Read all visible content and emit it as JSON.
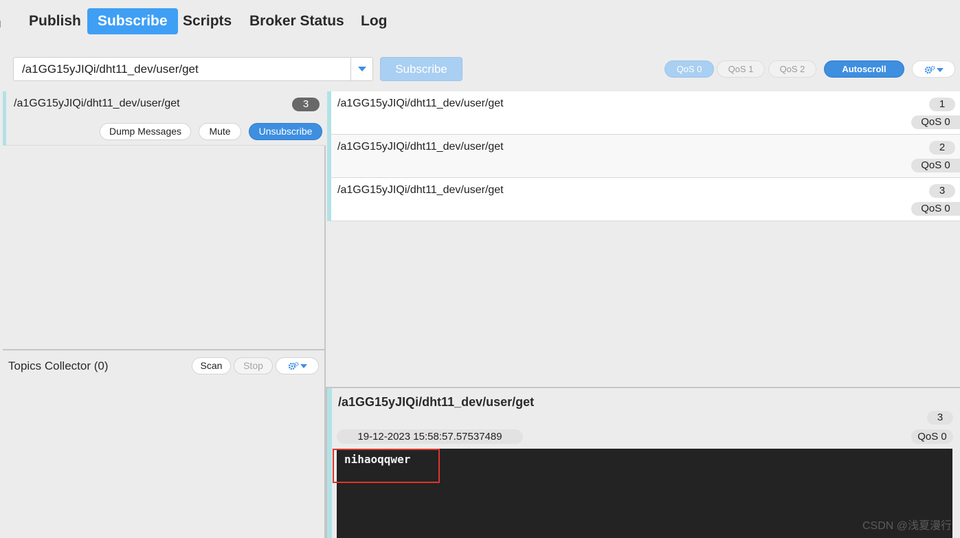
{
  "nav": {
    "tabs": [
      {
        "label": "Publish",
        "active": false
      },
      {
        "label": "Subscribe",
        "active": true
      },
      {
        "label": "Scripts",
        "active": false
      },
      {
        "label": "Broker Status",
        "active": false
      },
      {
        "label": "Log",
        "active": false
      }
    ]
  },
  "subscribe_bar": {
    "topic_value": "/a1GG15yJIQi/dht11_dev/user/get",
    "subscribe_label": "Subscribe",
    "qos_options": [
      "QoS 0",
      "QoS 1",
      "QoS 2"
    ],
    "selected_qos": "QoS 0",
    "autoscroll_label": "Autoscroll",
    "settings_icon": "gears-icon"
  },
  "subscriptions": [
    {
      "topic": "/a1GG15yJIQi/dht11_dev/user/get",
      "count": "3",
      "dump_label": "Dump Messages",
      "mute_label": "Mute",
      "unsubscribe_label": "Unsubscribe"
    }
  ],
  "topics_collector": {
    "title": "Topics Collector (0)",
    "scan_label": "Scan",
    "stop_label": "Stop",
    "settings_icon": "gears-icon"
  },
  "messages": [
    {
      "topic": "/a1GG15yJIQi/dht11_dev/user/get",
      "num": "1",
      "qos": "QoS 0"
    },
    {
      "topic": "/a1GG15yJIQi/dht11_dev/user/get",
      "num": "2",
      "qos": "QoS 0"
    },
    {
      "topic": "/a1GG15yJIQi/dht11_dev/user/get",
      "num": "3",
      "qos": "QoS 0"
    }
  ],
  "detail": {
    "topic": "/a1GG15yJIQi/dht11_dev/user/get",
    "num": "3",
    "timestamp": "19-12-2023  15:58:57.57537489",
    "qos": "QoS 0",
    "payload": "nihaoqqwer"
  },
  "watermark": "CSDN @浅夏漫行",
  "colors": {
    "accent_blue": "#3e8fe0",
    "subscribe_tab": "#3e9ff5",
    "topic_accent": "#b2e2e6",
    "payload_bg": "#232323",
    "highlight_red": "#e0342c"
  }
}
